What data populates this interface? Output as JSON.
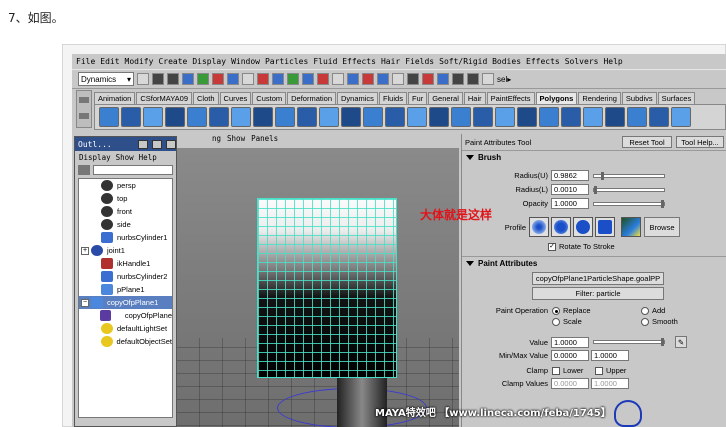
{
  "doc": {
    "caption": "7、如图。"
  },
  "menubar": {
    "items": [
      "File",
      "Edit",
      "Modify",
      "Create",
      "Display",
      "Window",
      "Particles",
      "Fluid Effects",
      "Hair",
      "Fields",
      "Soft/Rigid Bodies",
      "Effects",
      "Solvers",
      "Help"
    ]
  },
  "statusline": {
    "mode": "Dynamics",
    "sel_label": "sel▸"
  },
  "shelf": {
    "tabs": [
      "Animation",
      "CSforMAYA09",
      "Cloth",
      "Curves",
      "Custom",
      "Deformation",
      "Dynamics",
      "Fluids",
      "Fur",
      "General",
      "Hair",
      "PaintEffects",
      "Polygons",
      "Rendering",
      "Subdivs",
      "Surfaces"
    ],
    "active_tab": "Polygons"
  },
  "viewport": {
    "menu": [
      "ng",
      "Show",
      "Panels"
    ]
  },
  "outliner": {
    "title": "Outl...",
    "menu": [
      "Display",
      "Show",
      "Help"
    ],
    "items": [
      {
        "label": "persp",
        "icon": "camera-icon",
        "expand": ""
      },
      {
        "label": "top",
        "icon": "camera-icon",
        "expand": ""
      },
      {
        "label": "front",
        "icon": "camera-icon",
        "expand": ""
      },
      {
        "label": "side",
        "icon": "camera-icon",
        "expand": ""
      },
      {
        "label": "nurbsCylinder1",
        "icon": "nurbs-icon",
        "expand": ""
      },
      {
        "label": "joint1",
        "icon": "joint-icon",
        "expand": "+"
      },
      {
        "label": "ikHandle1",
        "icon": "ik-handle-icon",
        "expand": ""
      },
      {
        "label": "nurbsCylinder2",
        "icon": "nurbs-icon",
        "expand": ""
      },
      {
        "label": "pPlane1",
        "icon": "plane-icon",
        "expand": ""
      },
      {
        "label": "copyOfpPlane1",
        "icon": "plane-icon",
        "expand": "−",
        "selected": true
      },
      {
        "label": "copyOfpPlane",
        "icon": "particle-icon",
        "expand": "",
        "indent": true
      },
      {
        "label": "defaultLightSet",
        "icon": "set-icon",
        "expand": ""
      },
      {
        "label": "defaultObjectSet",
        "icon": "set-icon",
        "expand": ""
      }
    ]
  },
  "attr": {
    "tool_title": "Paint Attributes Tool",
    "reset_tool": "Reset Tool",
    "tool_help": "Tool Help...",
    "brush": {
      "title": "Brush",
      "radius_u_label": "Radius(U)",
      "radius_u": "0.9862",
      "radius_u_fraction": 0.1,
      "radius_l_label": "Radius(L)",
      "radius_l": "0.0010",
      "radius_l_fraction": 0.0,
      "opacity_label": "Opacity",
      "opacity": "1.0000",
      "opacity_fraction": 1.0,
      "profile_label": "Profile",
      "browse": "Browse",
      "rotate_to_stroke": "Rotate To Stroke",
      "rotate_checked": "✓"
    },
    "paint": {
      "title": "Paint Attributes",
      "attr_button": "copyOfpPlane1ParticleShape.goalPP",
      "filter_button": "Filter: particle",
      "operation_label": "Paint Operation",
      "ops": [
        "Replace",
        "Add",
        "Scale",
        "Smooth"
      ],
      "selected_op": "Replace",
      "value_label": "Value",
      "value": "1.0000",
      "value_fraction": 1.0,
      "minmax_label": "Min/Max Value",
      "min": "0.0000",
      "max": "1.0000",
      "clamp_label": "Clamp",
      "clamp_lower": "Lower",
      "clamp_upper": "Upper",
      "clamp_values_label": "Clamp Values",
      "clamp_min": "0.0000",
      "clamp_max": "1.0000"
    }
  },
  "annotation": {
    "text": "大体就是这样",
    "color": "#e0141a"
  },
  "watermark": {
    "text": "MAYA特效吧 【www.lineca.com/feba/1745】"
  }
}
